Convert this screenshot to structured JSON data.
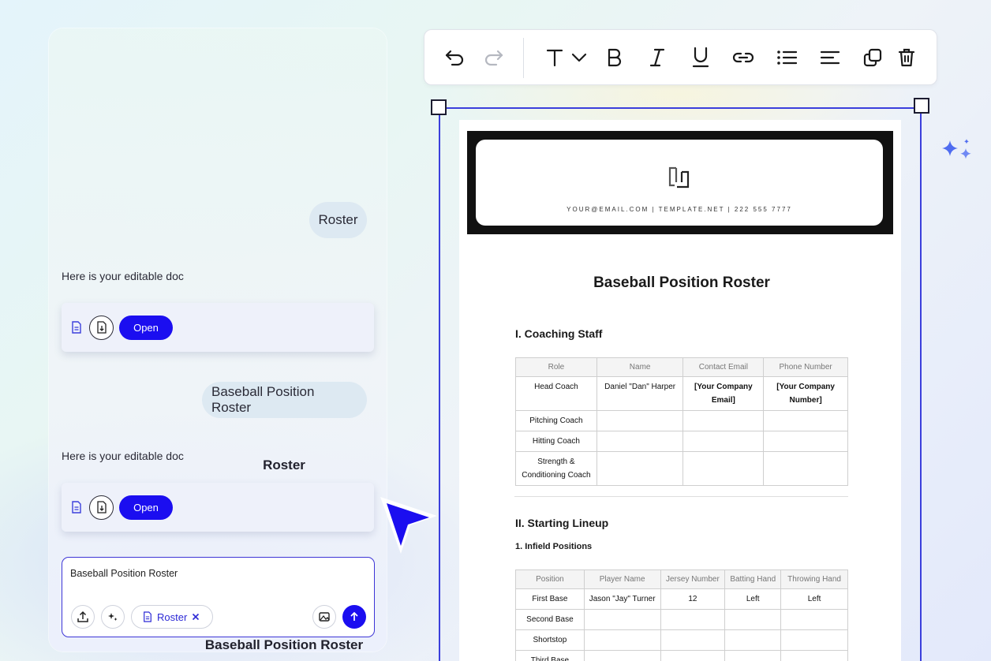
{
  "chat": {
    "messages": [
      {
        "role": "user",
        "text": "Roster"
      },
      {
        "role": "assistant",
        "text": "Here is your editable doc",
        "doc_title": "Roster",
        "open_label": "Open"
      },
      {
        "role": "user",
        "text": "Baseball Position Roster"
      },
      {
        "role": "assistant",
        "text": "Here is your editable doc",
        "doc_title": "Baseball Position Roster",
        "open_label": "Open"
      }
    ],
    "composer": {
      "value": "Baseball Position Roster",
      "chip_label": "Roster"
    }
  },
  "toolbar": {
    "icons": [
      "undo-icon",
      "redo-icon",
      "text-style-icon",
      "chevron-down-icon",
      "bold-icon",
      "italic-icon",
      "underline-icon",
      "link-icon",
      "bulleted-list-icon",
      "align-icon",
      "duplicate-icon",
      "delete-icon"
    ]
  },
  "document": {
    "header_contact": "YOUR@EMAIL.COM | TEMPLATE.NET | 222 555 7777",
    "title": "Baseball Position Roster",
    "section1": {
      "heading": "I. Coaching Staff",
      "columns": [
        "Role",
        "Name",
        "Contact Email",
        "Phone Number"
      ],
      "rows": [
        [
          "Head Coach",
          "Daniel \"Dan\" Harper",
          "[Your Company Email]",
          "[Your Company Number]"
        ],
        [
          "Pitching Coach",
          "",
          "",
          ""
        ],
        [
          "Hitting Coach",
          "",
          "",
          ""
        ],
        [
          "Strength & Conditioning Coach",
          "",
          "",
          ""
        ]
      ]
    },
    "section2": {
      "heading": "II. Starting Lineup",
      "subheading": "1. Infield Positions",
      "columns": [
        "Position",
        "Player Name",
        "Jersey Number",
        "Batting Hand",
        "Throwing Hand"
      ],
      "rows": [
        [
          "First Base",
          "Jason \"Jay\" Turner",
          "12",
          "Left",
          "Left"
        ],
        [
          "Second Base",
          "",
          "",
          "",
          ""
        ],
        [
          "Shortstop",
          "",
          "",
          "",
          ""
        ],
        [
          "Third Base",
          "",
          "",
          "",
          ""
        ]
      ]
    }
  },
  "colors": {
    "accent": "#1b0ef0",
    "selection": "#3b3fdc",
    "bubble": "#dde9f2"
  }
}
